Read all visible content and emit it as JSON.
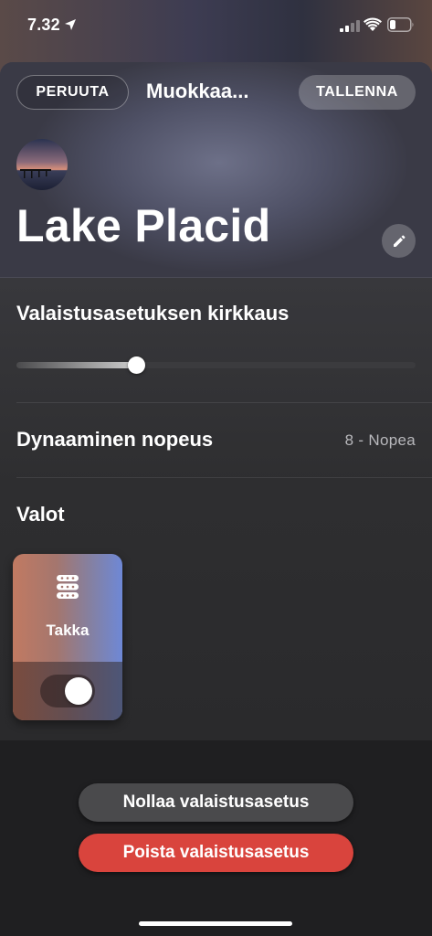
{
  "status_bar": {
    "time": "7.32",
    "icons": [
      "location-arrow-icon",
      "cellular-signal-icon",
      "wifi-icon",
      "battery-icon"
    ]
  },
  "nav": {
    "cancel_label": "PERUUTA",
    "title": "Muokkaa...",
    "save_label": "TALLENNA"
  },
  "scene": {
    "name": "Lake Placid",
    "edit_icon": "pencil-icon"
  },
  "brightness": {
    "label": "Valaistusasetuksen kirkkaus",
    "level": 0.3
  },
  "dynamic_speed": {
    "label": "Dynaaminen nopeus",
    "value": "8 - Nopea"
  },
  "lights": {
    "section_label": "Valot",
    "items": [
      {
        "name": "Takka",
        "icon": "lightstrip-icon",
        "on": true
      }
    ]
  },
  "actions": {
    "reset_label": "Nollaa valaistusasetus",
    "delete_label": "Poista valaistusasetus"
  },
  "colors": {
    "delete_button": "#d9443d",
    "reset_button": "#4a4a4c",
    "sheet_background": "#2a2a2c"
  }
}
